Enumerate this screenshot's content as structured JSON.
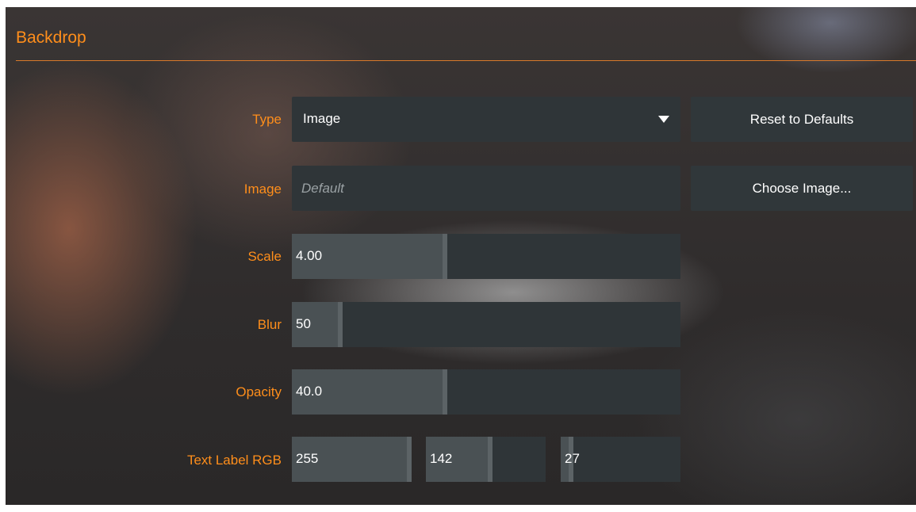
{
  "panel": {
    "title": "Backdrop"
  },
  "type_row": {
    "label": "Type",
    "value": "Image",
    "reset_label": "Reset to Defaults"
  },
  "image_row": {
    "label": "Image",
    "placeholder": "Default",
    "choose_label": "Choose Image..."
  },
  "scale_row": {
    "label": "Scale",
    "value": "4.00",
    "fraction": 0.4
  },
  "blur_row": {
    "label": "Blur",
    "value": "50",
    "fraction": 0.13
  },
  "opacity_row": {
    "label": "Opacity",
    "value": "40.0",
    "fraction": 0.4
  },
  "rgb_row": {
    "label": "Text Label RGB",
    "r": {
      "value": "255",
      "fraction": 1.0
    },
    "g": {
      "value": "142",
      "fraction": 0.557
    },
    "b": {
      "value": "27",
      "fraction": 0.106
    }
  },
  "colors": {
    "accent": "#ff8e1b",
    "control_bg": "#2f3538",
    "slider_fill": "#4a5154"
  },
  "icons": {
    "dropdown": "caret-down-icon"
  }
}
